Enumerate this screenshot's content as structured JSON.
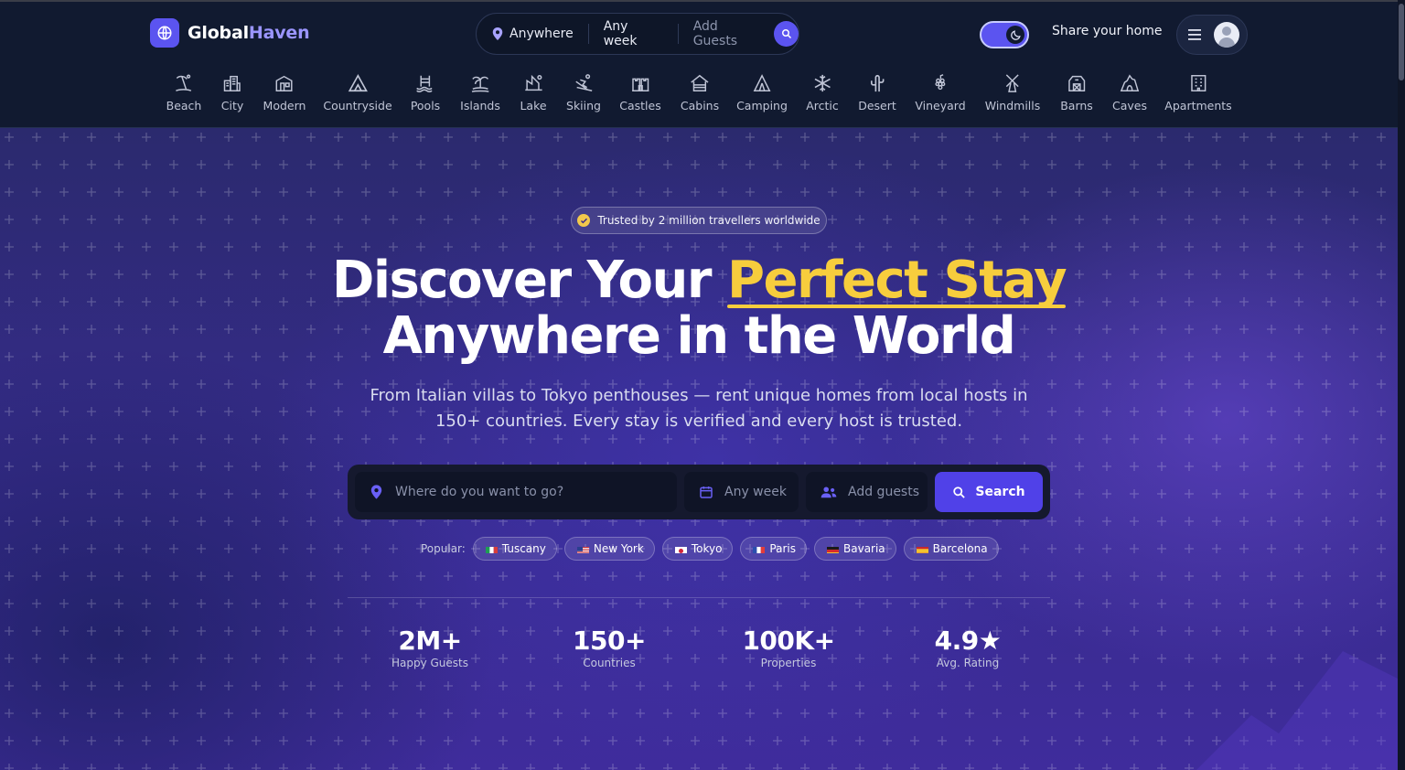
{
  "brand": {
    "name_part1": "Global",
    "name_part2": "Haven",
    "accent": "#5b54f0"
  },
  "mini_search": {
    "location": "Anywhere",
    "week": "Any week",
    "guests": "Add Guests"
  },
  "header": {
    "share_label": "Share your home",
    "theme": "dark"
  },
  "categories": [
    {
      "label": "Beach",
      "icon": "beach-icon"
    },
    {
      "label": "City",
      "icon": "city-icon"
    },
    {
      "label": "Modern",
      "icon": "modern-home-icon"
    },
    {
      "label": "Countryside",
      "icon": "countryside-icon"
    },
    {
      "label": "Pools",
      "icon": "pool-icon"
    },
    {
      "label": "Islands",
      "icon": "island-icon"
    },
    {
      "label": "Lake",
      "icon": "lake-icon"
    },
    {
      "label": "Skiing",
      "icon": "skiing-icon"
    },
    {
      "label": "Castles",
      "icon": "castle-icon"
    },
    {
      "label": "Cabins",
      "icon": "cabin-icon"
    },
    {
      "label": "Camping",
      "icon": "camping-icon"
    },
    {
      "label": "Arctic",
      "icon": "snowflake-icon"
    },
    {
      "label": "Desert",
      "icon": "cactus-icon"
    },
    {
      "label": "Vineyard",
      "icon": "grapes-icon"
    },
    {
      "label": "Windmills",
      "icon": "windmill-icon"
    },
    {
      "label": "Barns",
      "icon": "barn-icon"
    },
    {
      "label": "Caves",
      "icon": "cave-icon"
    },
    {
      "label": "Apartments",
      "icon": "apartment-icon"
    }
  ],
  "hero": {
    "badge": "Trusted by 2 million travellers worldwide",
    "title_part1": "Discover Your ",
    "title_accent": "Perfect Stay",
    "title_line2": "Anywhere in the World",
    "subtitle": "From Italian villas to Tokyo penthouses — rent unique homes from local hosts in 150+ countries. Every stay is verified and every host is trusted."
  },
  "search": {
    "where_placeholder": "Where do you want to go?",
    "week_placeholder": "Any week",
    "guests_placeholder": "Add guests",
    "button_label": "Search"
  },
  "popular": {
    "label": "Popular:",
    "items": [
      {
        "name": "Tuscany",
        "flag": "it"
      },
      {
        "name": "New York",
        "flag": "us"
      },
      {
        "name": "Tokyo",
        "flag": "jp"
      },
      {
        "name": "Paris",
        "flag": "fr"
      },
      {
        "name": "Bavaria",
        "flag": "de"
      },
      {
        "name": "Barcelona",
        "flag": "es"
      }
    ]
  },
  "stats": [
    {
      "value": "2M+",
      "label": "Happy Guests"
    },
    {
      "value": "150+",
      "label": "Countries"
    },
    {
      "value": "100K+",
      "label": "Properties"
    },
    {
      "value": "4.9★",
      "label": "Avg. Rating"
    }
  ],
  "colors": {
    "accent": "#5b54f0",
    "highlight": "#f7cd3d",
    "header_bg": "#111a30"
  }
}
